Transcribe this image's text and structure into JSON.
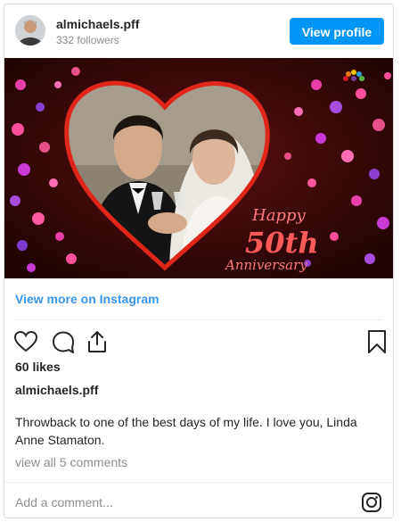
{
  "header": {
    "username": "almichaels.pff",
    "followers": "332 followers",
    "view_profile_label": "View profile"
  },
  "photo": {
    "overlay_line1": "Happy",
    "overlay_line2": "50th",
    "overlay_line3": "Anniversary",
    "accent_color": "#e0251b"
  },
  "post": {
    "view_more_label": "View more on Instagram",
    "likes": "60 likes",
    "author": "almichaels.pff",
    "caption": "Throwback to one of the best days of my life. I love you, Linda Anne Stamaton.",
    "comments_link": "view all 5 comments"
  },
  "footer": {
    "add_comment_placeholder": "Add a comment..."
  },
  "icons": {
    "like": "heart-icon",
    "comment": "comment-icon",
    "share": "share-icon",
    "save": "bookmark-icon",
    "instagram": "instagram-icon"
  },
  "colors": {
    "button": "#0095f6",
    "link": "#3897f0",
    "muted": "#8e8e8e"
  }
}
